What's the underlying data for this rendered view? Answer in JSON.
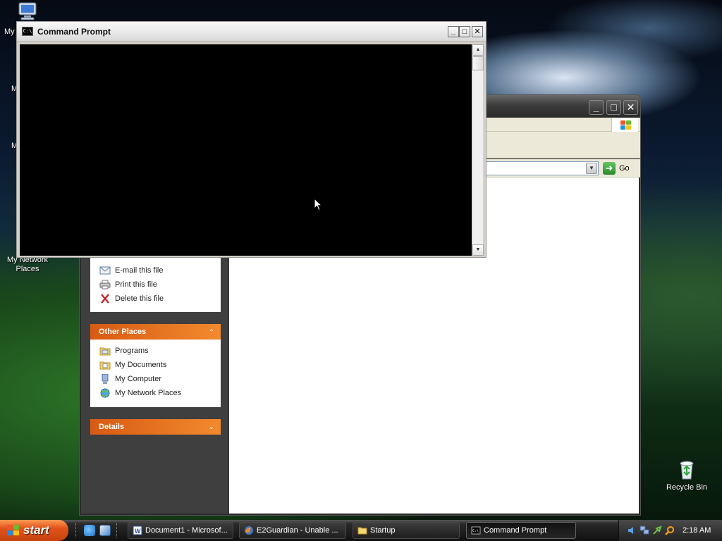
{
  "desktop": {
    "my_computer_fragment": "My",
    "my_documents_fragment": "M",
    "mfrag2": "M",
    "my_network_places": "My Network Places",
    "recycle_bin": "Recycle Bin"
  },
  "explorer": {
    "go_label": "Go",
    "file_tasks": {
      "items": [
        {
          "label": "E-mail this file",
          "icon": "email-icon"
        },
        {
          "label": "Print this file",
          "icon": "printer-icon"
        },
        {
          "label": "Delete this file",
          "icon": "delete-icon"
        }
      ]
    },
    "other_places": {
      "title": "Other Places",
      "items": [
        {
          "label": "Programs",
          "icon": "programs-folder-icon"
        },
        {
          "label": "My Documents",
          "icon": "my-documents-icon"
        },
        {
          "label": "My Computer",
          "icon": "my-computer-icon"
        },
        {
          "label": "My Network Places",
          "icon": "network-places-icon"
        }
      ]
    },
    "details": {
      "title": "Details"
    }
  },
  "command_prompt": {
    "title": "Command Prompt",
    "system_icon_text": "C:\\"
  },
  "taskbar": {
    "start_label": "start",
    "buttons": [
      {
        "label": "Document1 - Microsof...",
        "icon": "word-icon"
      },
      {
        "label": "E2Guardian - Unable ...",
        "icon": "firefox-icon"
      },
      {
        "label": "Startup",
        "icon": "folder-icon"
      },
      {
        "label": "Command Prompt",
        "icon": "cmd-icon",
        "active": true
      }
    ],
    "clock": "2:18 AM"
  },
  "colors": {
    "task_header": "#e2651d",
    "start_button": "#d9501a",
    "console_bg": "#000000"
  }
}
